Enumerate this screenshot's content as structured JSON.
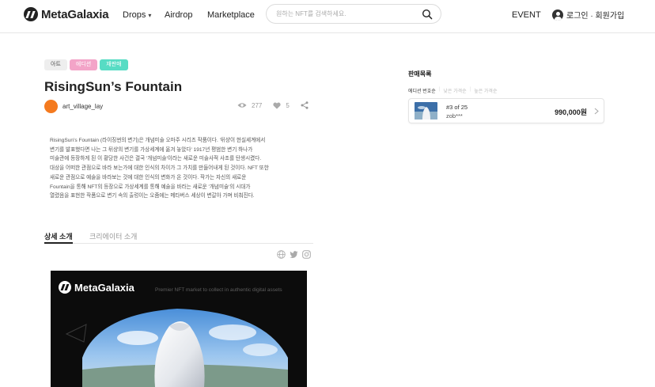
{
  "header": {
    "logo": "MetaGalaxia",
    "nav": {
      "drops": "Drops",
      "airdrop": "Airdrop",
      "marketplace": "Marketplace"
    },
    "search_placeholder": "원하는 NFT를 검색하세요.",
    "event": "EVENT",
    "login": "로그인 · 회원가입"
  },
  "item": {
    "tags": [
      "아트",
      "에디션",
      "재판매"
    ],
    "title": "RisingSun’s Fountain",
    "creator": "art_village_lay",
    "views": "277",
    "likes": "5",
    "description": [
      "RisingSun's Fountain (라이징썬의 변기)은 개념미술 오마주 시리즈 작품이다.  '뒤샹이 현실세계에서",
      "변기를 발표했다면 나는 그 뒤샹의 변기를 가상세계에 옮겨 놓았다' 1917년 평범한 변기 하나가",
      "미술관에 등장하게 된 이 황당한 사건은 결국 '개념미술'이라는 새로운 미술사적 사조를 탄생시켰다.",
      "대상을 어떠한 관점으로 바라 보는가에 대한 인식의 차이가 그 가치를 만들어내게 된 것이다. NFT 또한",
      "새로운 관점으로 예술을 바라보는 것에 대한 인식의 변화가 온 것이다. 작가는 자신의 새로운",
      "Fountain을 통해 NFT의 등장으로 가상세계를 통해 예술을 바라는 새로운 '개념미술'의 시대가",
      "열렸음을 표현한 작품으로 변기 속의 출렁이는 오줌에는 메타버스 세상이 변갈아 가며 비춰진다."
    ],
    "tabs": [
      "상세 소개",
      "크리에이터 소개"
    ],
    "banner": {
      "logo": "MetaGalaxia",
      "tagline": "Premier NFT market to collect in authentic digital assets"
    }
  },
  "sales": {
    "title": "판매목록",
    "sort": [
      "에디션 번호순",
      "낮은 가격순",
      "높은 가격순"
    ],
    "listings": [
      {
        "edition": "#3 of 25",
        "seller": "zob***",
        "price": "990,000원"
      }
    ]
  },
  "colors": {
    "accent_pink": "#f3a4c8",
    "accent_teal": "#57dcc4",
    "creator_orange": "#f47a1f"
  }
}
